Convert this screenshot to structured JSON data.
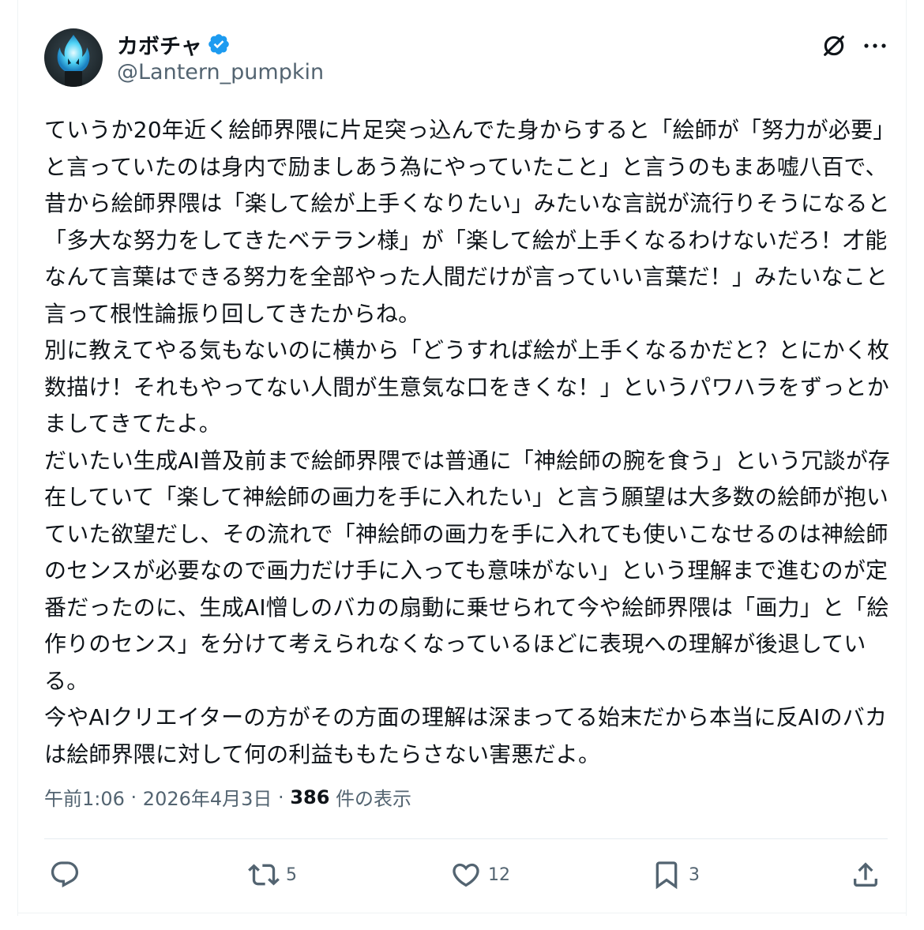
{
  "user": {
    "display_name": "カボチャ",
    "handle": "@Lantern_pumpkin",
    "verified": true,
    "avatar_icon": "blue-flame-avatar-icon"
  },
  "header_actions": {
    "grok_icon": "grok-icon",
    "more_icon": "more-dots-icon"
  },
  "post": {
    "text": "ていうか20年近く絵師界隈に片足突っ込んでた身からすると「絵師が「努力が必要」と言っていたのは身内で励ましあう為にやっていたこと」と言うのもまあ嘘八百で、昔から絵師界隈は「楽して絵が上手くなりたい」みたいな言説が流行りそうになると「多大な努力をしてきたベテラン様」が「楽して絵が上手くなるわけないだろ！才能なんて言葉はできる努力を全部やった人間だけが言っていい言葉だ！」みたいなこと言って根性論振り回してきたからね。\n別に教えてやる気もないのに横から「どうすれば絵が上手くなるかだと？とにかく枚数描け！それもやってない人間が生意気な口をきくな！」というパワハラをずっとかましてきてたよ。\nだいたい生成AI普及前まで絵師界隈では普通に「神絵師の腕を食う」という冗談が存在していて「楽して神絵師の画力を手に入れたい」と言う願望は大多数の絵師が抱いていた欲望だし、その流れで「神絵師の画力を手に入れても使いこなせるのは神絵師のセンスが必要なので画力だけ手に入っても意味がない」という理解まで進むのが定番だったのに、生成AI憎しのバカの扇動に乗せられて今や絵師界隈は「画力」と「絵作りのセンス」を分けて考えられなくなっているほどに表現への理解が後退している。\n今やAIクリエイターの方がその方面の理解は深まってる始末だから本当に反AIのバカは絵師界隈に対して何の利益ももたらさない害悪だよ。",
    "time": "午前1:06",
    "sep1": " · ",
    "date": "2026年4月3日",
    "sep2": " · ",
    "views_count": "386",
    "views_label": " 件の表示"
  },
  "actions": {
    "reply": {
      "icon": "reply-icon",
      "count": ""
    },
    "repost": {
      "icon": "repost-icon",
      "count": "5"
    },
    "like": {
      "icon": "heart-icon",
      "count": "12"
    },
    "bookmark": {
      "icon": "bookmark-icon",
      "count": "3"
    },
    "share": {
      "icon": "share-icon",
      "count": ""
    }
  },
  "colors": {
    "text": "#0f1419",
    "secondary": "#536471",
    "verified_blue": "#1d9bf0",
    "divider": "#eff3f4"
  }
}
